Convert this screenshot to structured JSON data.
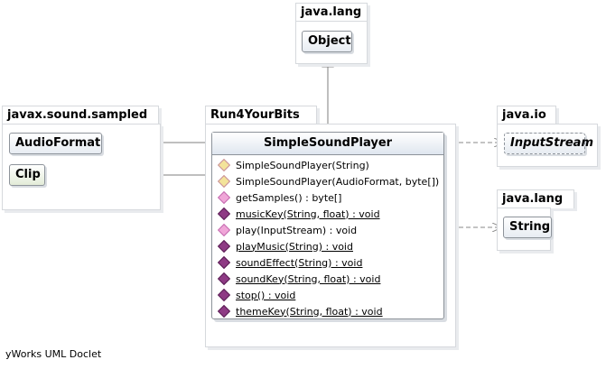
{
  "packages": {
    "java_lang_top": {
      "name": "java.lang",
      "classes": [
        "Object"
      ]
    },
    "javax_sound_sampled": {
      "name": "javax.sound.sampled",
      "classes": [
        "AudioFormat",
        "Clip"
      ]
    },
    "run4yourbits": {
      "name": "Run4YourBits"
    },
    "java_io": {
      "name": "java.io",
      "classes": [
        "InputStream"
      ]
    },
    "java_lang_right": {
      "name": "java.lang",
      "classes": [
        "String"
      ]
    }
  },
  "main_class": {
    "name": "SimpleSoundPlayer",
    "members": [
      {
        "text": "SimpleSoundPlayer(String)",
        "kind": "constructor",
        "static": false
      },
      {
        "text": "SimpleSoundPlayer(AudioFormat, byte[])",
        "kind": "constructor",
        "static": false
      },
      {
        "text": "getSamples() : byte[]",
        "kind": "public-method",
        "static": false
      },
      {
        "text": "musicKey(String, float) : void",
        "kind": "static-method",
        "static": true
      },
      {
        "text": "play(InputStream) : void",
        "kind": "public-method",
        "static": false
      },
      {
        "text": "playMusic(String) : void",
        "kind": "static-method",
        "static": true
      },
      {
        "text": "soundEffect(String) : void",
        "kind": "static-method",
        "static": true
      },
      {
        "text": "soundKey(String, float) : void",
        "kind": "static-method",
        "static": true
      },
      {
        "text": "stop() : void",
        "kind": "static-method",
        "static": true
      },
      {
        "text": "themeKey(String, float) : void",
        "kind": "static-method",
        "static": true
      }
    ]
  },
  "footer": "yWorks UML Doclet",
  "colors": {
    "line": "#7f7f7f",
    "border": "#8d939a",
    "static_icon": "#8e3a84",
    "public_icon": "#f0a6d8",
    "ctor_icon": "#f3e39a"
  }
}
